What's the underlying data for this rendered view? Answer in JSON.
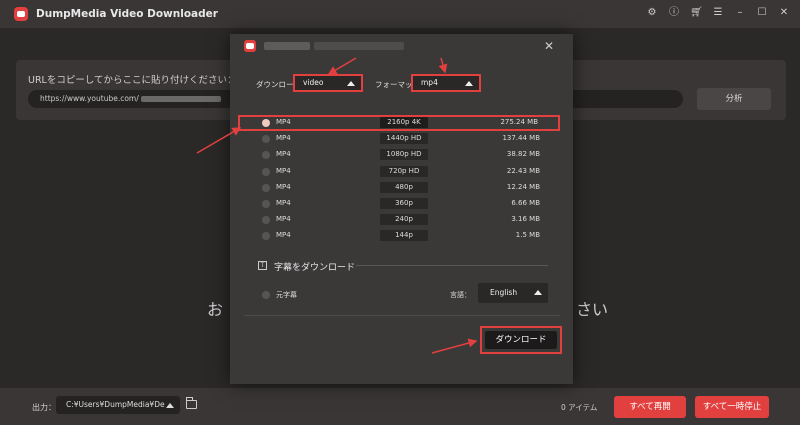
{
  "app": {
    "title": "DumpMedia Video Downloader"
  },
  "window_icons": [
    "gear-icon",
    "info-icon",
    "cart-icon",
    "menu-icon",
    "minimize-icon",
    "maximize-icon",
    "close-icon"
  ],
  "url_panel": {
    "label": "URLをコピーしてからここに貼り付けください：",
    "value": "https://www.youtube.com/",
    "analyze_label": "分析"
  },
  "background_text": {
    "left": "お",
    "right": "さい"
  },
  "modal": {
    "download_label": "ダウンロード：",
    "download_value": "video",
    "format_label": "フォーマット：",
    "format_value": "mp4",
    "formats": [
      {
        "format": "MP4",
        "resolution": "2160p 4K",
        "size": "275.24 MB",
        "selected": true
      },
      {
        "format": "MP4",
        "resolution": "1440p HD",
        "size": "137.44 MB",
        "selected": false
      },
      {
        "format": "MP4",
        "resolution": "1080p HD",
        "size": "38.82 MB",
        "selected": false
      },
      {
        "format": "MP4",
        "resolution": "720p HD",
        "size": "22.43 MB",
        "selected": false
      },
      {
        "format": "MP4",
        "resolution": "480p",
        "size": "12.24 MB",
        "selected": false
      },
      {
        "format": "MP4",
        "resolution": "360p",
        "size": "6.66 MB",
        "selected": false
      },
      {
        "format": "MP4",
        "resolution": "240p",
        "size": "3.16 MB",
        "selected": false
      },
      {
        "format": "MP4",
        "resolution": "144p",
        "size": "1.5 MB",
        "selected": false
      }
    ],
    "subtitle_section_title": "字幕をダウンロード",
    "subtitle_original": "元字幕",
    "language_label": "言語：",
    "language_value": "English",
    "download_button": "ダウンロード"
  },
  "bottom": {
    "output_label": "出力：",
    "output_path": "C:¥Users¥DumpMedia¥De",
    "item_count": "0 アイテム",
    "resume_all": "すべて再開",
    "pause_all": "すべて一時停止"
  },
  "colors": {
    "accent": "#e2403f",
    "background": "#2f2c2c",
    "panel": "#3b3838"
  }
}
